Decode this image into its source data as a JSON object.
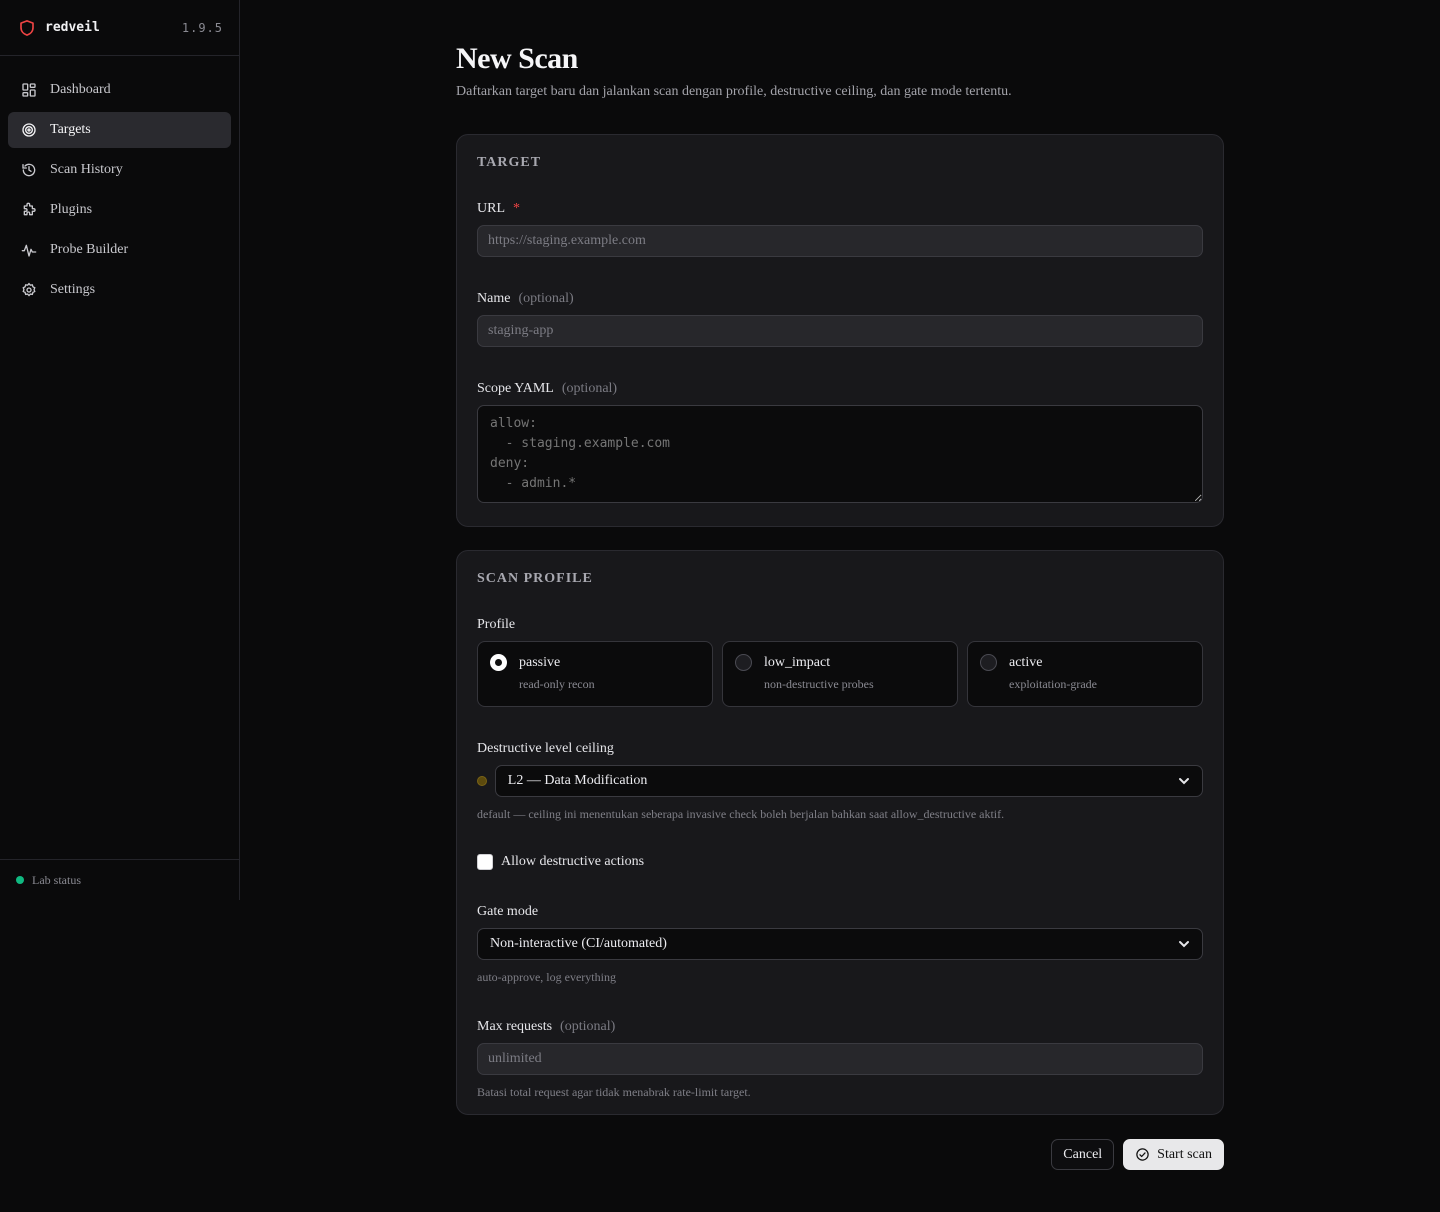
{
  "brand": {
    "name": "redveil",
    "version": "1.9.5",
    "logo_icon": "shield-icon",
    "accent": "#ef4444"
  },
  "nav": {
    "items": [
      {
        "label": "Dashboard",
        "icon": "dashboard-grid-icon",
        "active": false
      },
      {
        "label": "Targets",
        "icon": "target-icon",
        "active": true
      },
      {
        "label": "Scan History",
        "icon": "history-icon",
        "active": false
      },
      {
        "label": "Plugins",
        "icon": "puzzle-icon",
        "active": false
      },
      {
        "label": "Probe Builder",
        "icon": "waveform-icon",
        "active": false
      },
      {
        "label": "Settings",
        "icon": "gear-icon",
        "active": false
      }
    ]
  },
  "footer": {
    "status_label": "Lab status",
    "status_color": "#10b981"
  },
  "page": {
    "title": "New Scan",
    "subtitle": "Daftarkan target baru dan jalankan scan dengan profile, destructive ceiling, dan gate mode tertentu."
  },
  "target_section": {
    "title": "Target",
    "url": {
      "label": "URL",
      "required_mark": "*",
      "placeholder": "https://staging.example.com",
      "value": ""
    },
    "name": {
      "label": "Name",
      "optional": "(optional)",
      "placeholder": "staging-app",
      "value": ""
    },
    "scope": {
      "label": "Scope YAML",
      "optional": "(optional)",
      "placeholder": "allow:\n  - staging.example.com\ndeny:\n  - admin.*"
    }
  },
  "profile_section": {
    "title": "Scan Profile",
    "profile_label": "Profile",
    "profiles": [
      {
        "name": "passive",
        "desc": "read-only recon",
        "checked": true
      },
      {
        "name": "low_impact",
        "desc": "non-destructive probes",
        "checked": false
      },
      {
        "name": "active",
        "desc": "exploitation-grade",
        "checked": false
      }
    ],
    "destructive": {
      "label": "Destructive level ceiling",
      "selected": "L2 — Data Modification",
      "hint": "default — ceiling ini menentukan seberapa invasive check boleh berjalan bahkan saat allow_destructive aktif.",
      "level_color": "#5c4a0e"
    },
    "allow_destructive": {
      "label": "Allow destructive actions",
      "checked": false
    },
    "gate_mode": {
      "label": "Gate mode",
      "selected": "Non-interactive (CI/automated)",
      "hint": "auto-approve, log everything"
    },
    "max_requests": {
      "label": "Max requests",
      "optional": "(optional)",
      "placeholder": "unlimited",
      "hint": "Batasi total request agar tidak menabrak rate-limit target."
    }
  },
  "actions": {
    "cancel_label": "Cancel",
    "start_label": "Start scan",
    "start_icon": "check-circle-icon"
  }
}
